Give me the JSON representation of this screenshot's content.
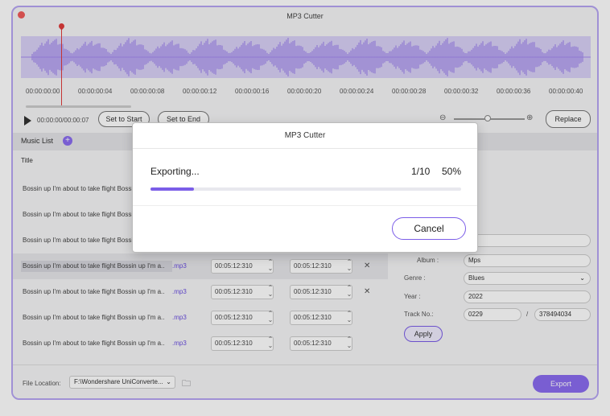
{
  "window": {
    "title": "MP3 Cutter"
  },
  "timeline": {
    "labels": [
      "00:00:00:00",
      "00:00:00:04",
      "00:00:00:08",
      "00:00:00:12",
      "00:00:00:16",
      "00:00:00:20",
      "00:00:00:24",
      "00:00:00:28",
      "00:00:00:32",
      "00:00:00:36",
      "00:00:00:40"
    ]
  },
  "controls": {
    "time_readout": "00:00:00/00:00:07",
    "set_to_start": "Set to Start",
    "set_to_end": "Set to End",
    "replace": "Replace"
  },
  "music_list": {
    "title": "Music List",
    "column_title": "Title",
    "rows": [
      {
        "name": "Bossin up I'm about to take flight Bossin up I'm a",
        "ext": "",
        "start": "",
        "end": "",
        "show_times": false
      },
      {
        "name": "Bossin up I'm about to take flight Bossin up I'm a",
        "ext": "",
        "start": "",
        "end": "",
        "show_times": false
      },
      {
        "name": "Bossin up I'm about to take flight Bossin up I'm a",
        "ext": "",
        "start": "",
        "end": "",
        "show_times": false
      },
      {
        "name": "Bossin up I'm about to take flight Bossin up I'm a..",
        "ext": ".mp3",
        "start": "00:05:12:310",
        "end": "00:05:12:310",
        "show_times": true
      },
      {
        "name": "Bossin up I'm about to take flight Bossin up I'm a..",
        "ext": ".mp3",
        "start": "00:05:12:310",
        "end": "00:05:12:310",
        "show_times": true
      },
      {
        "name": "Bossin up I'm about to take flight Bossin up I'm a..",
        "ext": ".mp3",
        "start": "00:05:12:310",
        "end": "00:05:12:310",
        "show_times": true
      },
      {
        "name": "Bossin up I'm about to take flight Bossin up I'm a..",
        "ext": ".mp3",
        "start": "00:05:12:310",
        "end": "00:05:12:310",
        "show_times": true
      }
    ]
  },
  "info_panel": {
    "album_label": "Album :",
    "album_value": "Mps",
    "genre_label": "Genre :",
    "genre_value": "Blues",
    "year_label": "Year :",
    "year_value": "2022",
    "track_label": "Track No.:",
    "track_value": "0229",
    "track_sep": "/",
    "track_total": "378494034",
    "apply": "Apply"
  },
  "footer": {
    "file_location_label": "File Location:",
    "file_location_value": "F:\\Wondershare UniConverte...",
    "export": "Export"
  },
  "dialog": {
    "title": "MP3 Cutter",
    "status": "Exporting...",
    "count": "1/10",
    "percent": "50%",
    "progress": 0.14,
    "cancel": "Cancel"
  },
  "colors": {
    "accent": "#8a6cf0",
    "waveform": "#a48af0",
    "playhead": "#e03c3c"
  }
}
